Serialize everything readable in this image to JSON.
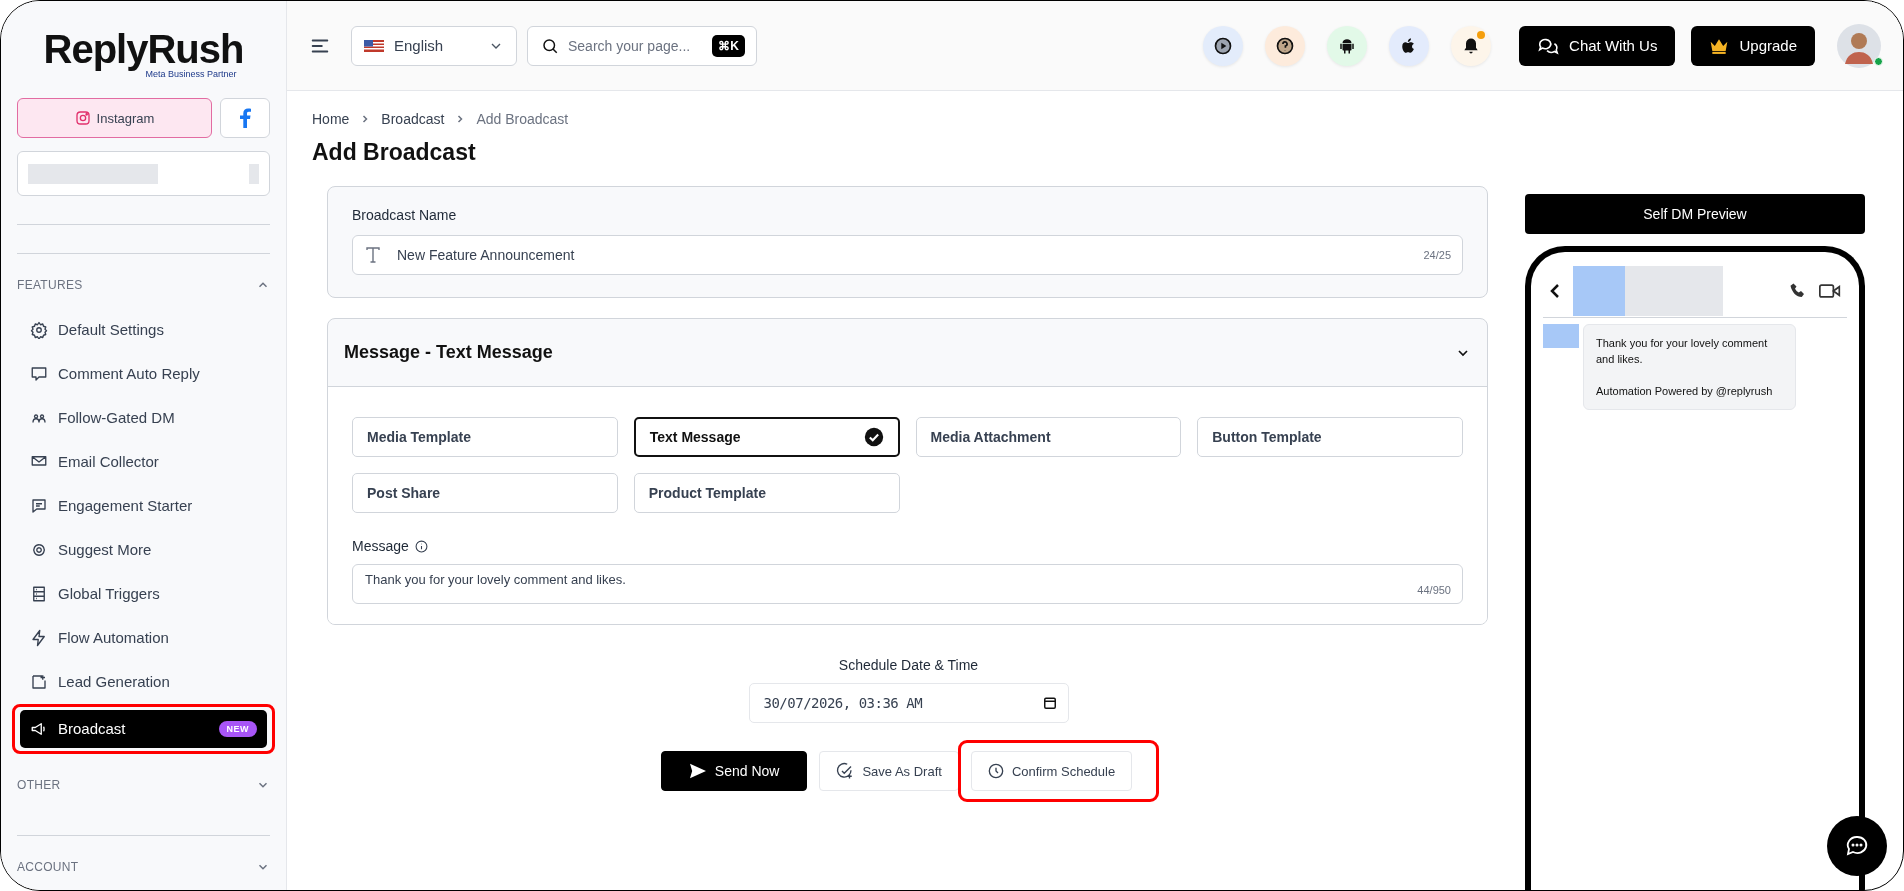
{
  "sidebar": {
    "logo": "ReplyRush",
    "logo_tagline": "Meta Business Partner",
    "platforms": [
      {
        "label": "Instagram",
        "selected": true
      },
      {
        "selected": false
      }
    ],
    "sections": [
      {
        "title": "FEATURES",
        "expanded": true,
        "items": [
          {
            "label": "Default Settings",
            "selected": false
          },
          {
            "label": "Comment Auto Reply",
            "selected": false
          },
          {
            "label": "Follow-Gated DM",
            "selected": false
          },
          {
            "label": "Email Collector",
            "selected": false
          },
          {
            "label": "Engagement Starter",
            "selected": false
          },
          {
            "label": "Suggest More",
            "selected": false
          },
          {
            "label": "Global Triggers",
            "selected": false
          },
          {
            "label": "Flow Automation",
            "selected": false
          },
          {
            "label": "Lead Generation",
            "selected": false
          },
          {
            "label": "Broadcast",
            "selected": true,
            "badge": "NEW",
            "highlighted": true
          }
        ]
      },
      {
        "title": "OTHER",
        "expanded": false
      },
      {
        "title": "ACCOUNT",
        "expanded": false
      }
    ]
  },
  "header": {
    "language": "English",
    "search": {
      "placeholder": "Search your page...",
      "shortcut": "⌘K"
    },
    "notification_dot": true,
    "buttons": [
      "Chat With Us",
      "Upgrade"
    ],
    "avatar_online": true
  },
  "breadcrumb": [
    "Home",
    "Broadcast",
    "Add Broadcast"
  ],
  "title": "Add Broadcast",
  "name_card": {
    "label": "Broadcast Name",
    "value": "New Feature Announcement",
    "counter": "24/25"
  },
  "message_card": {
    "title": "Message - Text Message",
    "expanded": true,
    "options": [
      {
        "label": "Media Template",
        "selected": false
      },
      {
        "label": "Text Message",
        "selected": true
      },
      {
        "label": "Media Attachment",
        "selected": false
      },
      {
        "label": "Button Template",
        "selected": false
      },
      {
        "label": "Post Share",
        "selected": false
      },
      {
        "label": "Product Template",
        "selected": false
      }
    ],
    "message_label": "Message",
    "message_value": "Thank you for your lovely comment and likes.",
    "counter": "44/950"
  },
  "schedule": {
    "label": "Schedule Date & Time",
    "value": "30/07/2026, 03:36 AM"
  },
  "actions": [
    {
      "label": "Send Now",
      "kind": "primary",
      "highlighted": false
    },
    {
      "label": "Save As Draft",
      "kind": "draft",
      "highlighted": false
    },
    {
      "label": "Confirm Schedule",
      "kind": "schedule",
      "highlighted": true
    }
  ],
  "preview": {
    "title": "Self DM Preview",
    "message": "Thank you for your lovely comment and likes.",
    "footer": "Automation Powered by @replyrush"
  }
}
